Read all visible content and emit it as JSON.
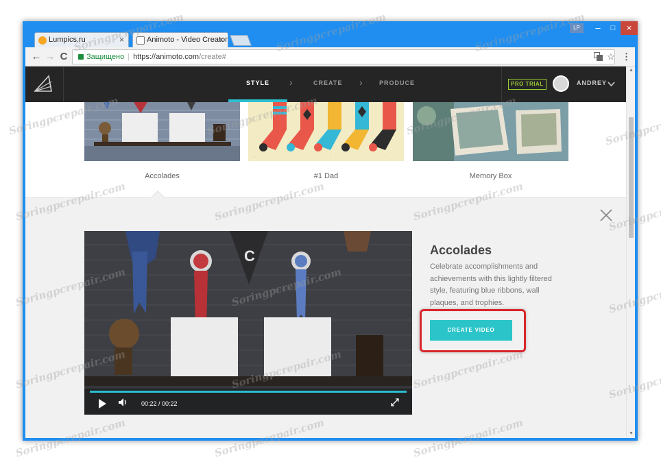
{
  "browser": {
    "tabs": [
      {
        "title": "Lumpics.ru",
        "close": "×"
      },
      {
        "title": "Animoto - Video Creator",
        "close": "×"
      }
    ],
    "window": {
      "user_badge": "LP",
      "minimize": "–",
      "maximize": "□",
      "close": "×"
    },
    "nav": {
      "back": "←",
      "forward": "→",
      "reload": "C"
    },
    "address": {
      "secure_label": "Защищено",
      "url_host": "https://animoto.com",
      "url_path": "/create#"
    },
    "icons": {
      "translate": "translate-icon",
      "star": "☆",
      "menu": "⋮"
    }
  },
  "app_nav": {
    "steps": [
      "STYLE",
      "CREATE",
      "PRODUCE"
    ],
    "active_step": "STYLE",
    "badge": "PRO TRIAL",
    "user_name": "ANDREY"
  },
  "styles": [
    {
      "label": "Accolades"
    },
    {
      "label": "#1 Dad"
    },
    {
      "label": "Memory Box"
    }
  ],
  "detail": {
    "title": "Accolades",
    "description": "Celebrate accomplishments and achievements with this lightly filtered style, featuring blue ribbons, wall plaques, and trophies.",
    "cta": "CREATE VIDEO",
    "video_time": "00:22 / 00:22"
  },
  "watermark": "Soringpcrepair.com",
  "colors": {
    "accent": "#2bc5c9",
    "nav_bg": "#252525",
    "panel_bg": "#f1f1f1",
    "highlight": "#d9252a",
    "pro": "#9acd32"
  }
}
